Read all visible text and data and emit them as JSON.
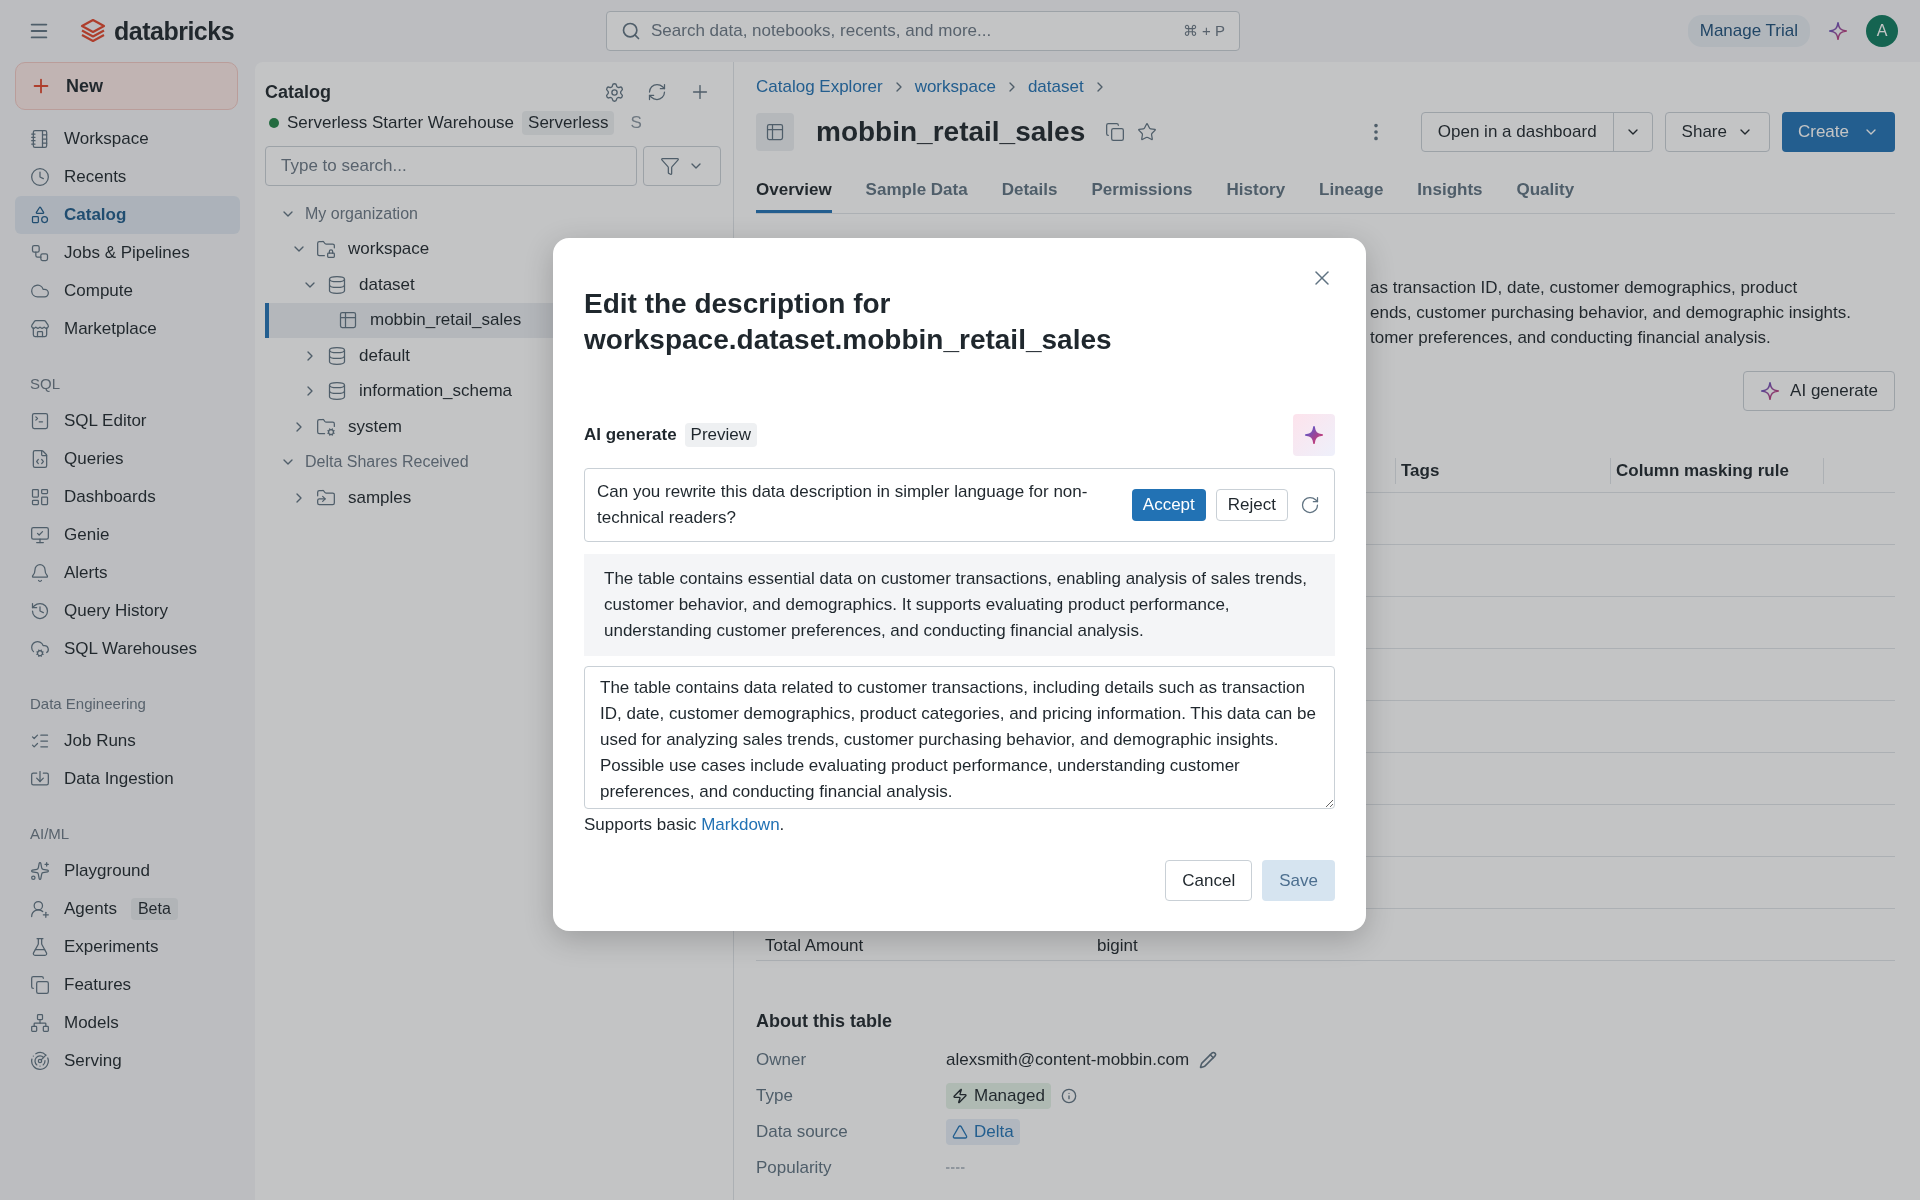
{
  "topbar": {
    "brand": "databricks",
    "search": {
      "placeholder": "Search data, notebooks, recents, and more...",
      "shortcut": "⌘ + P"
    },
    "manage_trial": "Manage Trial",
    "avatar": "A"
  },
  "sidebar": {
    "new_button": "New",
    "sections": [
      {
        "items": [
          {
            "label": "Workspace",
            "selected": false
          },
          {
            "label": "Recents",
            "selected": false
          },
          {
            "label": "Catalog",
            "selected": true
          },
          {
            "label": "Jobs & Pipelines",
            "selected": false
          },
          {
            "label": "Compute",
            "selected": false
          },
          {
            "label": "Marketplace",
            "selected": false
          }
        ]
      },
      {
        "heading": "SQL",
        "items": [
          {
            "label": "SQL Editor",
            "selected": false
          },
          {
            "label": "Queries",
            "selected": false
          },
          {
            "label": "Dashboards",
            "selected": false
          },
          {
            "label": "Genie",
            "selected": false
          },
          {
            "label": "Alerts",
            "selected": false
          },
          {
            "label": "Query History",
            "selected": false
          },
          {
            "label": "SQL Warehouses",
            "selected": false
          }
        ]
      },
      {
        "heading": "Data Engineering",
        "items": [
          {
            "label": "Job Runs",
            "selected": false
          },
          {
            "label": "Data Ingestion",
            "selected": false
          }
        ]
      },
      {
        "heading": "AI/ML",
        "items": [
          {
            "label": "Playground",
            "selected": false
          },
          {
            "label": "Agents",
            "badge": "Beta",
            "selected": false
          },
          {
            "label": "Experiments",
            "selected": false
          },
          {
            "label": "Features",
            "selected": false
          },
          {
            "label": "Models",
            "selected": false
          },
          {
            "label": "Serving",
            "selected": false
          }
        ]
      }
    ]
  },
  "catalog": {
    "title": "Catalog",
    "warehouse": {
      "name": "Serverless Starter Warehouse",
      "badge": "Serverless",
      "suffix": "S",
      "color": "#236b40"
    },
    "search": {
      "placeholder": "Type to search..."
    },
    "tree": [
      {
        "label": "My organization",
        "kind": "group",
        "expanded": true,
        "selected": false,
        "children": [
          {
            "label": "workspace",
            "kind": "catalog",
            "expanded": true,
            "selected": false,
            "children": [
              {
                "label": "dataset",
                "kind": "schema",
                "expanded": true,
                "selected": false,
                "children": [
                  {
                    "label": "mobbin_retail_sales",
                    "kind": "table",
                    "selected": true
                  }
                ]
              },
              {
                "label": "default",
                "kind": "schema",
                "expanded": false,
                "selected": false
              },
              {
                "label": "information_schema",
                "kind": "schema",
                "expanded": false,
                "selected": false
              }
            ]
          },
          {
            "label": "system",
            "kind": "system",
            "expanded": false,
            "selected": false
          }
        ]
      },
      {
        "label": "Delta Shares Received",
        "kind": "group",
        "expanded": true,
        "selected": false,
        "children": [
          {
            "label": "samples",
            "kind": "share",
            "expanded": false,
            "selected": false
          }
        ]
      }
    ]
  },
  "main": {
    "breadcrumb": [
      "Catalog Explorer",
      "workspace",
      "dataset"
    ],
    "title": "mobbin_retail_sales",
    "actions": {
      "open_dashboard": "Open in a dashboard",
      "share": "Share",
      "create": "Create"
    },
    "tabs": [
      {
        "label": "Overview",
        "selected": true
      },
      {
        "label": "Sample Data",
        "selected": false
      },
      {
        "label": "Details",
        "selected": false
      },
      {
        "label": "Permissions",
        "selected": false
      },
      {
        "label": "History",
        "selected": false
      },
      {
        "label": "Lineage",
        "selected": false
      },
      {
        "label": "Insights",
        "selected": false
      },
      {
        "label": "Quality",
        "selected": false
      }
    ],
    "description_fragments": [
      "as transaction ID, date, customer demographics, product",
      "ends, customer purchasing behavior, and demographic insights.",
      "tomer preferences, and conducting financial analysis."
    ],
    "ai_generate_button": "AI generate",
    "table": {
      "columns": [
        "Tags",
        "Column masking rule"
      ],
      "rows": [
        {
          "column_1": "Total Amount",
          "column_2": "bigint"
        }
      ]
    },
    "about": {
      "title": "About this table",
      "fields": [
        {
          "label": "Owner",
          "value": "alexsmith@content-mobbin.com",
          "kind": "owner"
        },
        {
          "label": "Type",
          "value": "Managed",
          "kind": "managed"
        },
        {
          "label": "Data source",
          "value": "Delta",
          "kind": "delta"
        },
        {
          "label": "Popularity",
          "kind": "popularity"
        }
      ]
    }
  },
  "modal": {
    "title": "Edit the description for workspace.dataset.mobbin_retail_sales",
    "ai_label": "AI generate",
    "ai_badge": "Preview",
    "prompt": "Can you rewrite this data description in simpler language for non-technical readers?",
    "accept": "Accept",
    "reject": "Reject",
    "suggestion": "The table contains essential data on customer transactions, enabling analysis of sales trends, customer behavior, and demographics. It supports evaluating product performance, understanding customer preferences, and conducting financial analysis.",
    "description_value": "The table contains data related to customer transactions, including details such as transaction ID, date, customer demographics, product categories, and pricing information. This data can be used for analyzing sales trends, customer purchasing behavior, and demographic insights. Possible use cases include evaluating product performance, understanding customer preferences, and conducting financial analysis.",
    "help": {
      "text": "Supports basic",
      "link": "Markdown",
      "after": "."
    },
    "cancel": "Cancel",
    "save": {
      "label": "Save",
      "disabled": true
    }
  }
}
